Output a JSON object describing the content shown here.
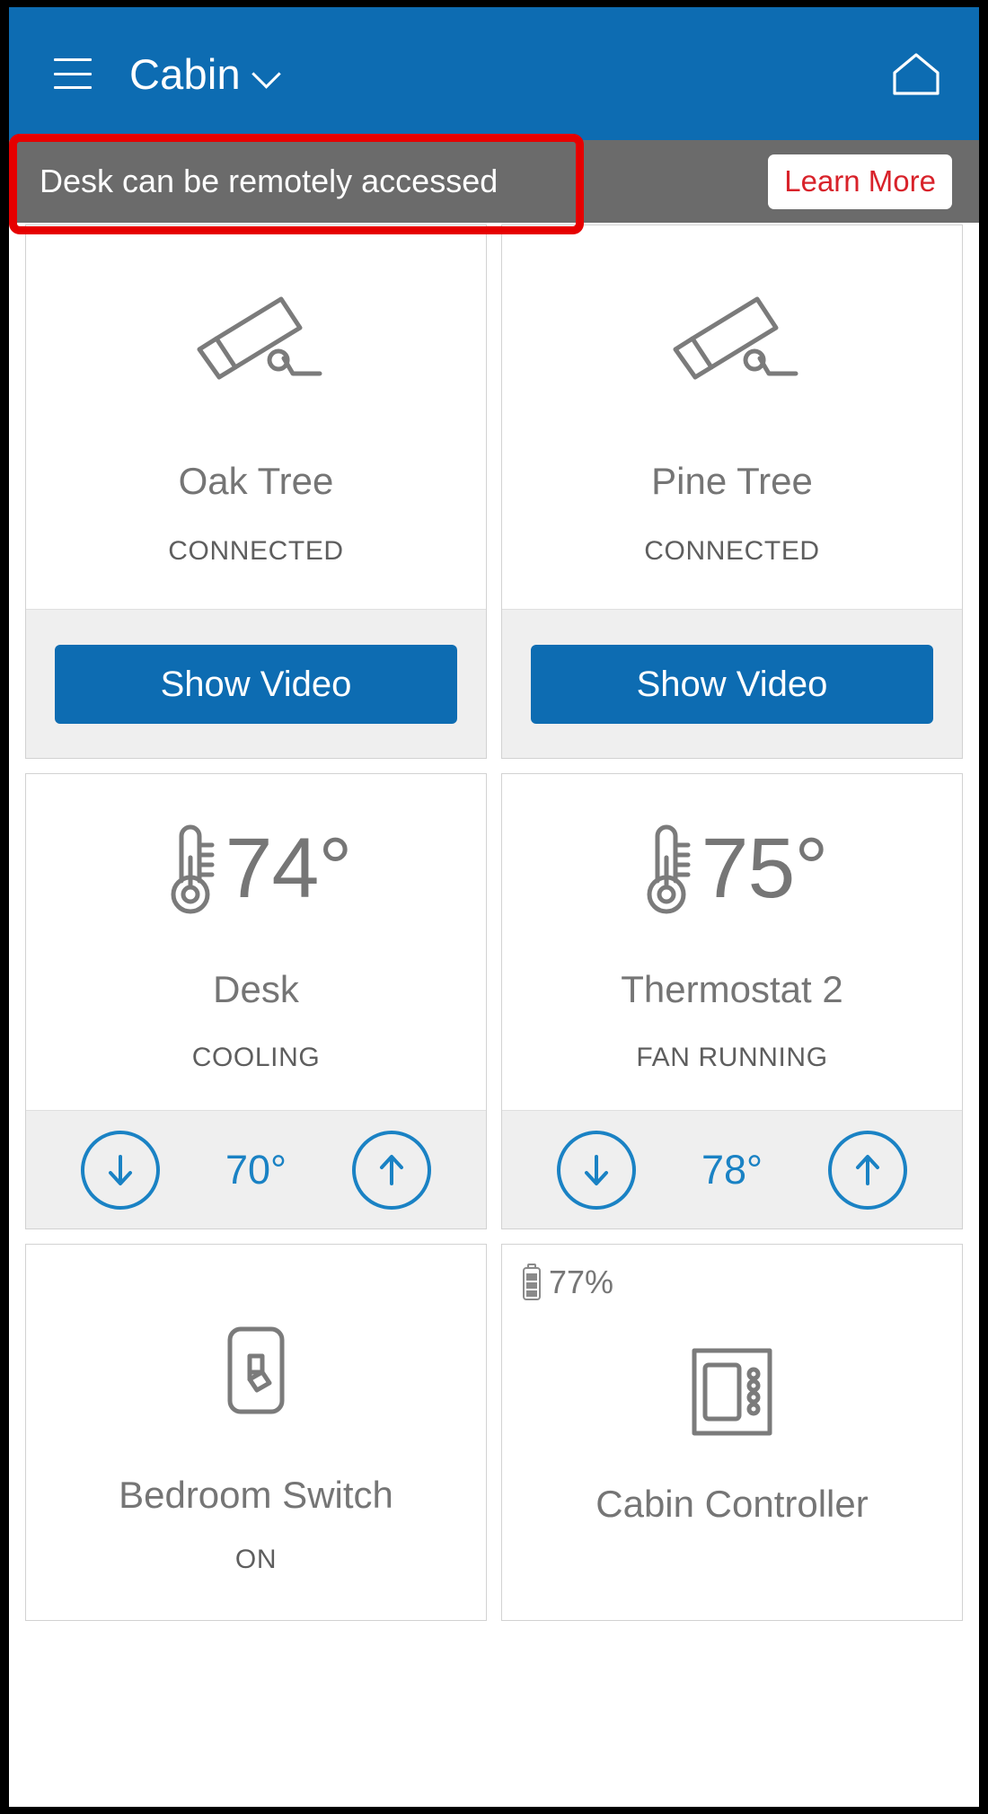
{
  "appbar": {
    "menu_icon": "hamburger-menu-icon",
    "title": "Cabin",
    "dropdown_icon": "chevron-down-icon",
    "home_icon": "home-icon",
    "background_color": "#0d6cb2"
  },
  "banner": {
    "message": "Desk can be remotely accessed",
    "action_label": "Learn More",
    "background_color": "#6b6b6b",
    "action_color": "#d8222a",
    "highlight_color": "#e60000"
  },
  "cards": [
    {
      "type": "camera",
      "icon": "cctv-camera-icon",
      "name": "Oak Tree",
      "status": "CONNECTED",
      "action_label": "Show Video"
    },
    {
      "type": "camera",
      "icon": "cctv-camera-icon",
      "name": "Pine Tree",
      "status": "CONNECTED",
      "action_label": "Show Video"
    },
    {
      "type": "thermostat",
      "icon": "thermometer-icon",
      "temperature": "74°",
      "name": "Desk",
      "status": "COOLING",
      "setpoint": "70°",
      "decrease_icon": "arrow-down-circle-icon",
      "increase_icon": "arrow-up-circle-icon"
    },
    {
      "type": "thermostat",
      "icon": "thermometer-icon",
      "temperature": "75°",
      "name": "Thermostat 2",
      "status": "FAN RUNNING",
      "setpoint": "78°",
      "decrease_icon": "arrow-down-circle-icon",
      "increase_icon": "arrow-up-circle-icon"
    },
    {
      "type": "switch",
      "icon": "light-switch-icon",
      "name": "Bedroom Switch",
      "status": "ON"
    },
    {
      "type": "controller",
      "icon": "controller-panel-icon",
      "battery_icon": "battery-icon",
      "battery_level": "77%",
      "name": "Cabin Controller"
    }
  ],
  "colors": {
    "primary_blue": "#0d6cb2",
    "accent_blue": "#1a82c4",
    "card_border": "#d2d2d2",
    "footer_gray": "#efefef",
    "text_gray": "#757575"
  }
}
